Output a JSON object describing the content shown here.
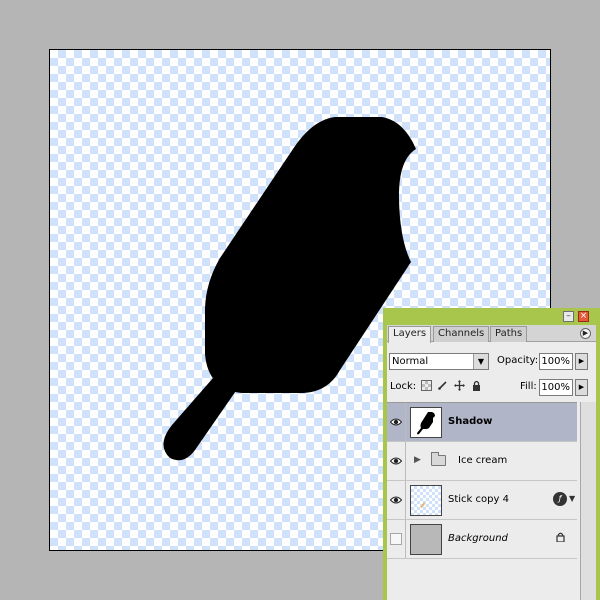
{
  "canvas": {
    "shape_color": "#000000",
    "checker_color": "#cfe1fb",
    "background_color": "#b5b5b5"
  },
  "palette": {
    "accent": "#a9c64c",
    "window_buttons": {
      "minimize": "minimize-icon",
      "close": "close-icon"
    },
    "tabs": [
      {
        "label": "Layers",
        "active": true
      },
      {
        "label": "Channels",
        "active": false
      },
      {
        "label": "Paths",
        "active": false
      }
    ],
    "menu_icon": "palette-menu-icon",
    "blend_mode": "Normal",
    "opacity": {
      "label": "Opacity:",
      "value": "100%"
    },
    "lock": {
      "label": "Lock:",
      "icons": [
        "lock-transparent-icon",
        "lock-image-icon",
        "lock-position-icon",
        "lock-all-icon"
      ]
    },
    "fill": {
      "label": "Fill:",
      "value": "100%"
    },
    "layers": [
      {
        "name": "Shadow",
        "visible": true,
        "selected": true,
        "type": "layer"
      },
      {
        "name": "Ice cream",
        "visible": true,
        "selected": false,
        "type": "group"
      },
      {
        "name": "Stick copy 4",
        "visible": true,
        "selected": false,
        "type": "layer",
        "has_effects": true
      },
      {
        "name": "Background",
        "visible": false,
        "selected": false,
        "type": "background",
        "locked": true
      }
    ]
  }
}
